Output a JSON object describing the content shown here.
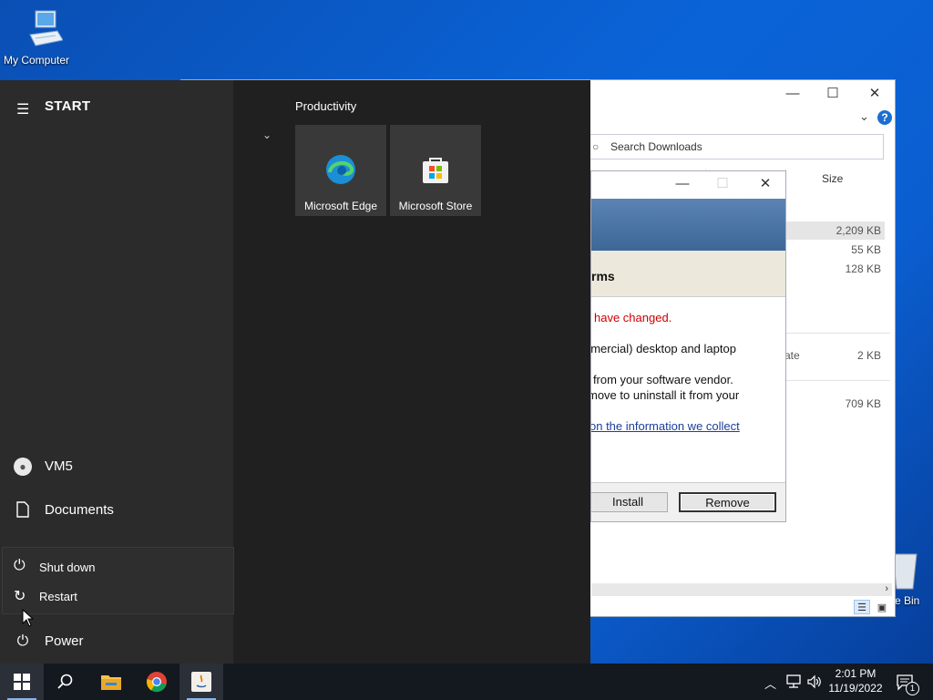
{
  "desktop": {
    "my_computer_label": "My Computer",
    "recycle_bin_label_partial": "e Bin"
  },
  "explorer": {
    "search_placeholder": "Search Downloads",
    "column_size": "Size",
    "rows": [
      {
        "name": "",
        "size": "2,209 KB"
      },
      {
        "name": "",
        "size": "55 KB"
      },
      {
        "name": "",
        "size": "128 KB"
      },
      {
        "name": "ate",
        "size": "2 KB"
      },
      {
        "name": "",
        "size": "709 KB"
      }
    ]
  },
  "dialog": {
    "heading_partial": "rms",
    "line1_partial": "have changed.",
    "line2_partial": "nmercial) desktop and laptop",
    "line3_partial": "r from your software vendor.",
    "line4_partial": "move to uninstall it from your",
    "link_partial": "on the information we collect",
    "install_label": "Install",
    "remove_label": "Remove"
  },
  "start_menu": {
    "title": "START",
    "user": "VM5",
    "documents": "Documents",
    "shutdown": "Shut down",
    "restart": "Restart",
    "power": "Power",
    "group_title": "Productivity",
    "tiles": [
      {
        "label": "Microsoft Edge"
      },
      {
        "label": "Microsoft Store"
      }
    ]
  },
  "taskbar": {
    "time": "2:01 PM",
    "date": "11/19/2022",
    "notification_count": "1"
  }
}
